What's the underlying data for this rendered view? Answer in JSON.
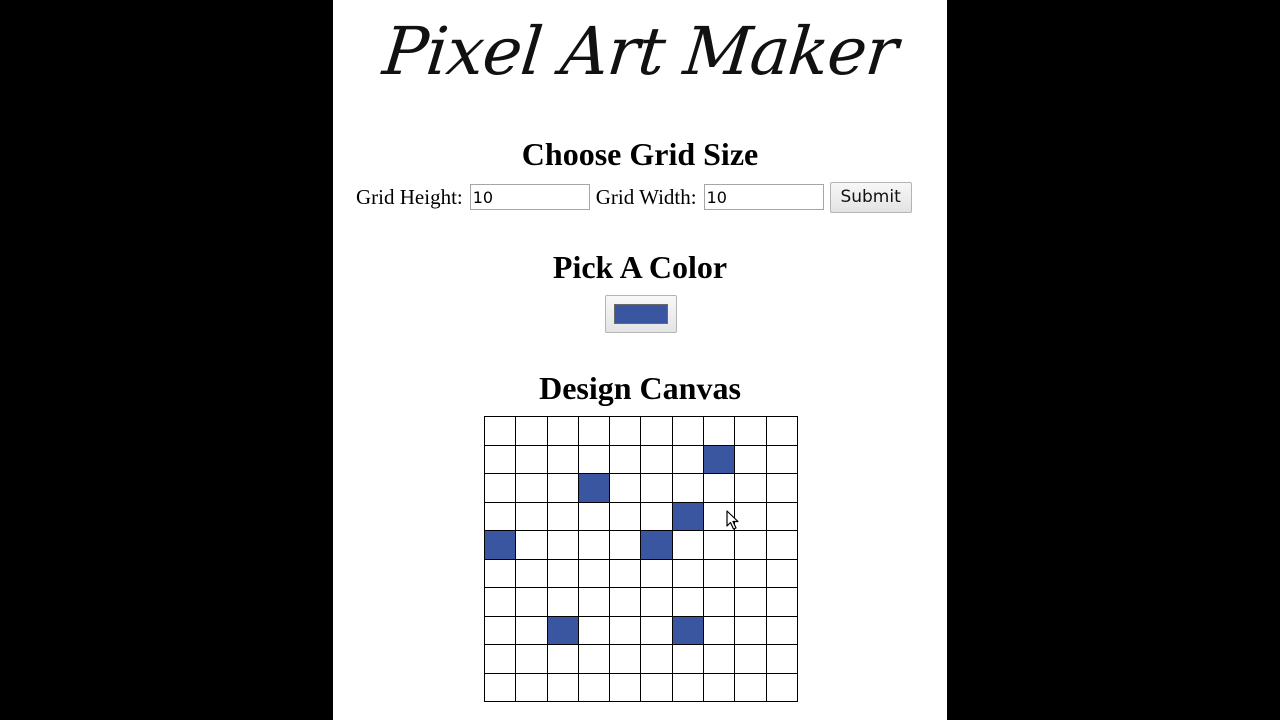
{
  "app": {
    "title": "Pixel Art Maker"
  },
  "grid_size": {
    "heading": "Choose Grid Size",
    "height_label": "Grid Height:",
    "height_value": "10",
    "width_label": "Grid Width:",
    "width_value": "10",
    "submit_label": "Submit"
  },
  "color": {
    "heading": "Pick A Color",
    "value": "#3a56a0"
  },
  "canvas": {
    "heading": "Design Canvas",
    "rows": 10,
    "cols": 10,
    "empty_color": "#ffffff",
    "filled_cells": [
      [
        1,
        7
      ],
      [
        2,
        3
      ],
      [
        3,
        6
      ],
      [
        4,
        0
      ],
      [
        4,
        5
      ],
      [
        7,
        2
      ],
      [
        7,
        6
      ]
    ]
  },
  "icons": {
    "cursor": "mouse-pointer-icon"
  }
}
